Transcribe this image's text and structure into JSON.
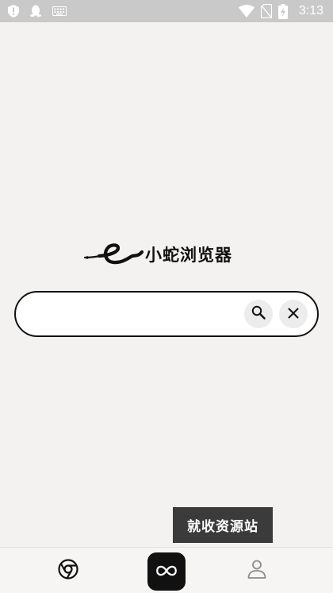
{
  "status_bar": {
    "time": "3:13",
    "left_icons": [
      "shield-alert-icon",
      "qq-penguin-icon",
      "keyboard-icon"
    ],
    "right_icons": [
      "wifi-icon",
      "no-sim-icon",
      "battery-charging-icon"
    ]
  },
  "logo": {
    "text": "小蛇浏览器",
    "mark_icon": "snake-e-logo"
  },
  "search": {
    "value": "",
    "placeholder": "",
    "search_icon": "search-icon",
    "clear_icon": "close-icon"
  },
  "toast": {
    "text": "就收资源站"
  },
  "bottom_nav": {
    "items": [
      {
        "icon": "chrome-browser-icon",
        "active": false
      },
      {
        "icon": "infinity-icon",
        "active": true
      },
      {
        "icon": "person-icon",
        "active": false
      }
    ]
  },
  "colors": {
    "background": "#f3f2f0",
    "status_bar": "#c9c9c9",
    "accent": "#111111",
    "toast_bg": "#3b3b3b"
  }
}
